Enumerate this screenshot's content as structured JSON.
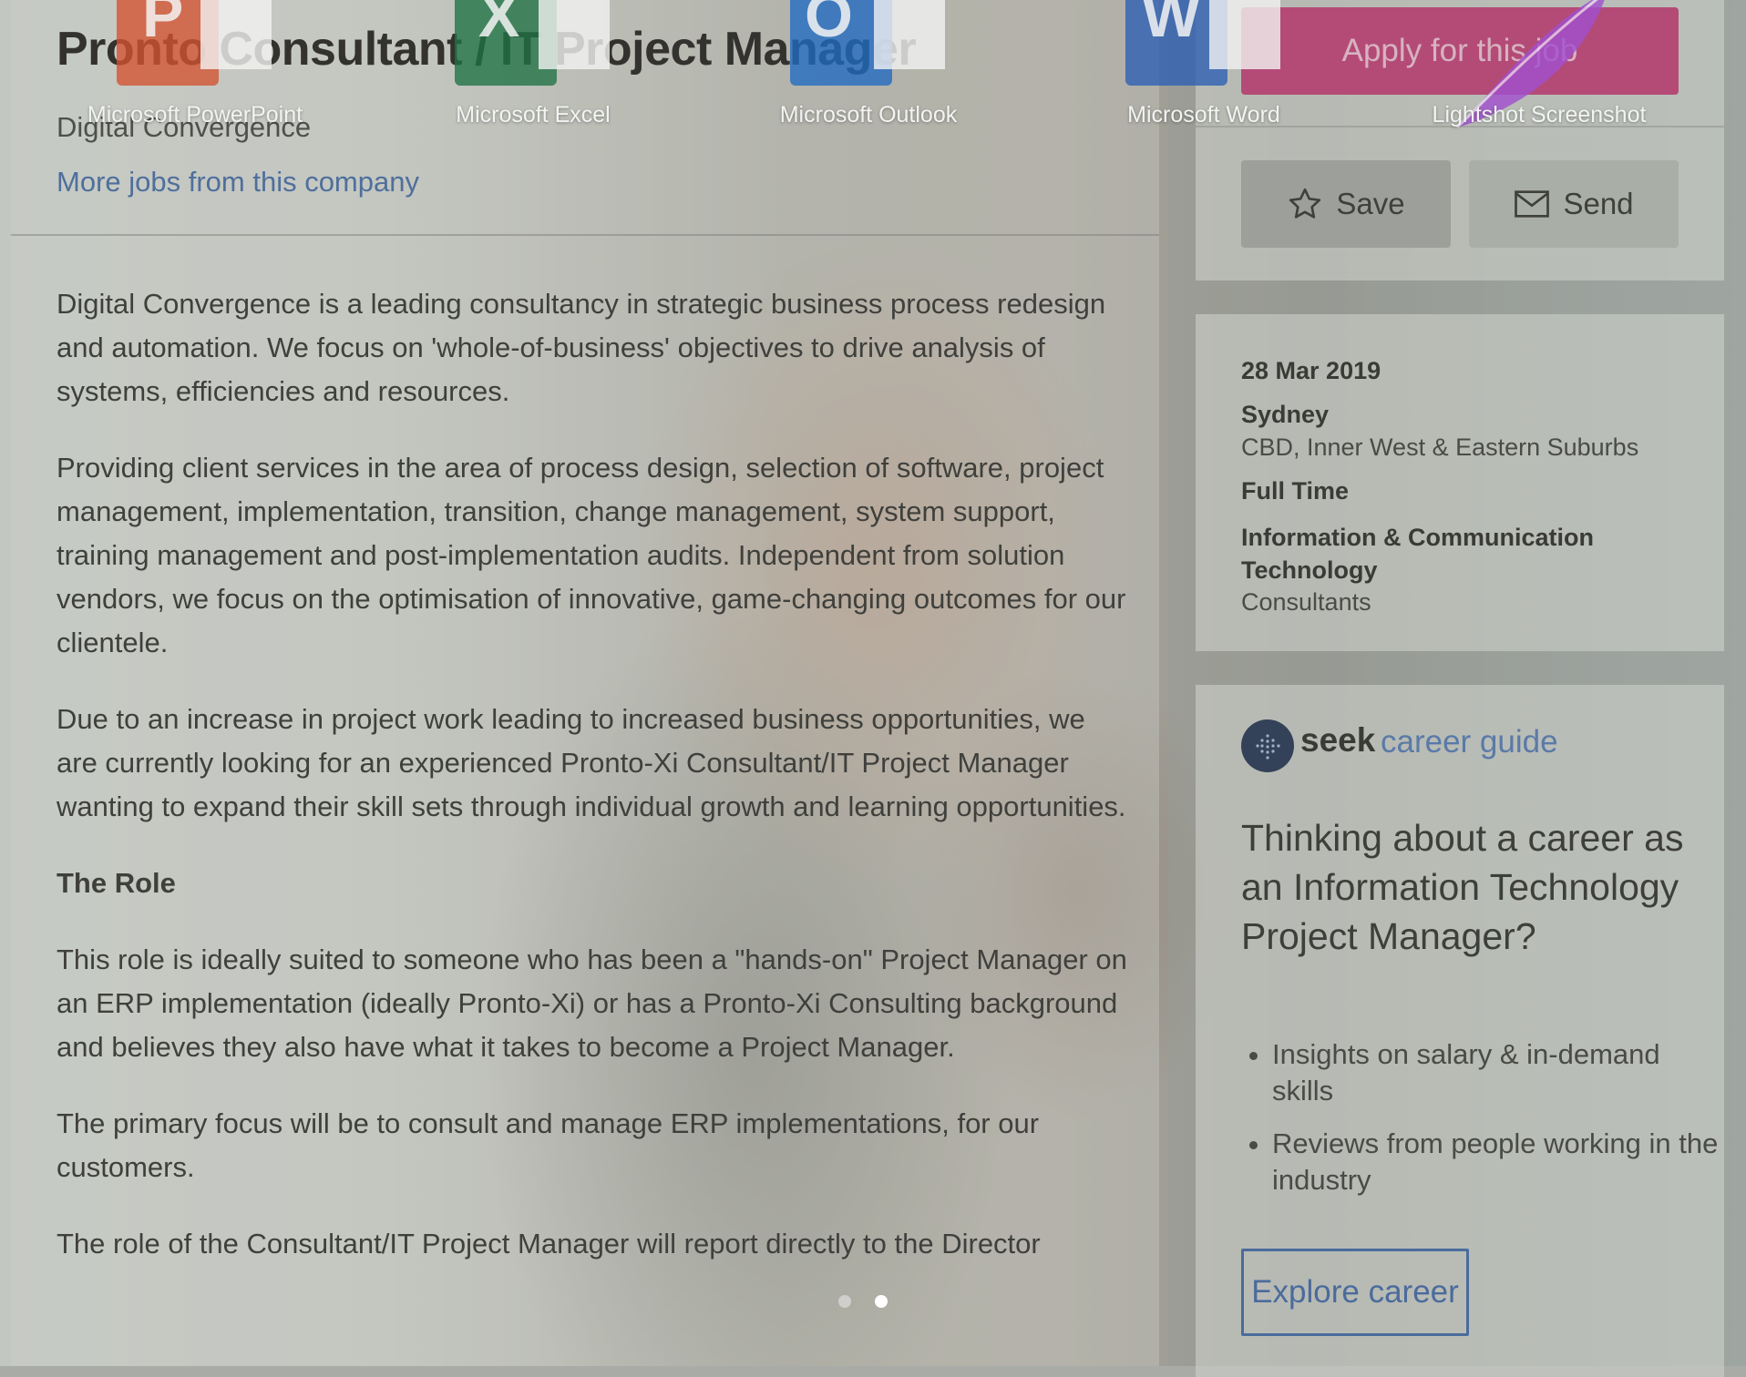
{
  "job": {
    "title": "Pronto Consultant / IT Project Manager",
    "company": "Digital Convergence",
    "more_jobs_link": "More jobs from this company"
  },
  "description": {
    "paragraphs": [
      "Digital Convergence is a leading consultancy in strategic business process redesign and automation. We focus on 'whole-of-business' objectives to drive analysis of systems, efficiencies and resources.",
      "Providing client services in the area of process design, selection of software, project management, implementation, transition, change management, system support, training management and post-implementation audits.  Independent from solution vendors, we focus on the optimisation of innovative, game-changing outcomes for our clientele.",
      "Due to an increase in project work leading to increased business opportunities, we are currently looking for an experienced Pronto-Xi Consultant/IT Project Manager wanting to expand their skill sets through individual growth and learning opportunities.",
      "This role is ideally suited to someone who has been a \"hands-on\" Project Manager on an ERP implementation (ideally Pronto-Xi) or has a Pronto-Xi Consulting background and believes they also have what it takes to become a Project Manager.",
      "The primary focus will be to consult and manage ERP implementations, for our customers.",
      "The role of the Consultant/IT Project Manager will report directly to the Director"
    ],
    "role_heading": "The Role"
  },
  "actions": {
    "apply_label": "Apply for this job",
    "save_label": "Save",
    "send_label": "Send"
  },
  "meta": {
    "date": "28 Mar 2019",
    "city": "Sydney",
    "area": "CBD, Inner West & Eastern Suburbs",
    "work_type": "Full Time",
    "classification": "Information & Communication Technology",
    "sub_classification": "Consultants"
  },
  "career_guide": {
    "brand": "seek",
    "brand_suffix": "career guide",
    "heading": "Thinking about a career as an Information Technology Project Manager?",
    "bullets": [
      "Insights on salary & in-demand skills",
      "Reviews from people working in the industry"
    ],
    "button_label": "Explore career"
  },
  "dock": {
    "apps": [
      {
        "label": "Microsoft PowerPoint",
        "letter": "P",
        "icon": "powerpoint-icon",
        "color": "#d35230"
      },
      {
        "label": "Microsoft Excel",
        "letter": "X",
        "icon": "excel-icon",
        "color": "#1f7244"
      },
      {
        "label": "Microsoft Outlook",
        "letter": "O",
        "icon": "outlook-icon",
        "color": "#1f6ac1"
      },
      {
        "label": "Microsoft Word",
        "letter": "W",
        "icon": "word-icon",
        "color": "#2b5fb3"
      },
      {
        "label": "Lightshot Screenshot",
        "letter": "",
        "icon": "lightshot-feather-icon",
        "color": "#9b4fc2"
      }
    ],
    "page_dots": [
      {
        "active": false
      },
      {
        "active": true
      }
    ]
  },
  "colors": {
    "apply_button": "#b44b76",
    "link": "#4f6f9c",
    "explore_border": "#4b6b9c"
  }
}
